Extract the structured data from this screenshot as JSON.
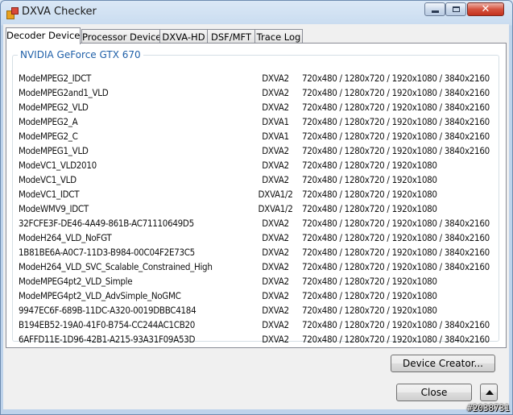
{
  "window": {
    "title": "DXVA Checker"
  },
  "tabs": [
    {
      "label": "Decoder Device",
      "active": true
    },
    {
      "label": "Processor Device",
      "active": false
    },
    {
      "label": "DXVA-HD",
      "active": false
    },
    {
      "label": "DSF/MFT",
      "active": false
    },
    {
      "label": "Trace Log",
      "active": false
    }
  ],
  "group": {
    "title": "NVIDIA GeForce GTX 670"
  },
  "modes": [
    {
      "name": "ModeMPEG2_IDCT",
      "type": "DXVA2",
      "res": "720x480 / 1280x720 / 1920x1080 / 3840x2160"
    },
    {
      "name": "ModeMPEG2and1_VLD",
      "type": "DXVA2",
      "res": "720x480 / 1280x720 / 1920x1080 / 3840x2160"
    },
    {
      "name": "ModeMPEG2_VLD",
      "type": "DXVA2",
      "res": "720x480 / 1280x720 / 1920x1080 / 3840x2160"
    },
    {
      "name": "ModeMPEG2_A",
      "type": "DXVA1",
      "res": "720x480 / 1280x720 / 1920x1080 / 3840x2160"
    },
    {
      "name": "ModeMPEG2_C",
      "type": "DXVA1",
      "res": "720x480 / 1280x720 / 1920x1080 / 3840x2160"
    },
    {
      "name": "ModeMPEG1_VLD",
      "type": "DXVA2",
      "res": "720x480 / 1280x720 / 1920x1080 / 3840x2160"
    },
    {
      "name": "ModeVC1_VLD2010",
      "type": "DXVA2",
      "res": "720x480 / 1280x720 / 1920x1080"
    },
    {
      "name": "ModeVC1_VLD",
      "type": "DXVA2",
      "res": "720x480 / 1280x720 / 1920x1080"
    },
    {
      "name": "ModeVC1_IDCT",
      "type": "DXVA1/2",
      "res": "720x480 / 1280x720 / 1920x1080"
    },
    {
      "name": "ModeWMV9_IDCT",
      "type": "DXVA1/2",
      "res": "720x480 / 1280x720 / 1920x1080"
    },
    {
      "name": "32FCFE3F-DE46-4A49-861B-AC71110649D5",
      "type": "DXVA2",
      "res": "720x480 / 1280x720 / 1920x1080 / 3840x2160"
    },
    {
      "name": "ModeH264_VLD_NoFGT",
      "type": "DXVA2",
      "res": "720x480 / 1280x720 / 1920x1080 / 3840x2160"
    },
    {
      "name": "1B81BE6A-A0C7-11D3-B984-00C04F2E73C5",
      "type": "DXVA2",
      "res": "720x480 / 1280x720 / 1920x1080 / 3840x2160"
    },
    {
      "name": "ModeH264_VLD_SVC_Scalable_Constrained_High",
      "type": "DXVA2",
      "res": "720x480 / 1280x720 / 1920x1080 / 3840x2160"
    },
    {
      "name": "ModeMPEG4pt2_VLD_Simple",
      "type": "DXVA2",
      "res": "720x480 / 1280x720 / 1920x1080"
    },
    {
      "name": "ModeMPEG4pt2_VLD_AdvSimple_NoGMC",
      "type": "DXVA2",
      "res": "720x480 / 1280x720 / 1920x1080"
    },
    {
      "name": "9947EC6F-689B-11DC-A320-0019DBBC4184",
      "type": "DXVA2",
      "res": "720x480 / 1280x720 / 1920x1080"
    },
    {
      "name": "B194EB52-19A0-41F0-B754-CC244AC1CB20",
      "type": "DXVA2",
      "res": "720x480 / 1280x720 / 1920x1080 / 3840x2160"
    },
    {
      "name": "6AFFD11E-1D96-42B1-A215-93A31F09A53D",
      "type": "DXVA2",
      "res": "720x480 / 1280x720 / 1920x1080 / 3840x2160"
    }
  ],
  "buttons": {
    "device_creator": "Device Creator...",
    "close": "Close"
  },
  "icons": {
    "app": "app-icon",
    "minimize": "minimize-icon",
    "maximize": "maximize-icon",
    "close": "close-icon",
    "collapse": "arrow-up-icon"
  },
  "watermark": "#2038731"
}
